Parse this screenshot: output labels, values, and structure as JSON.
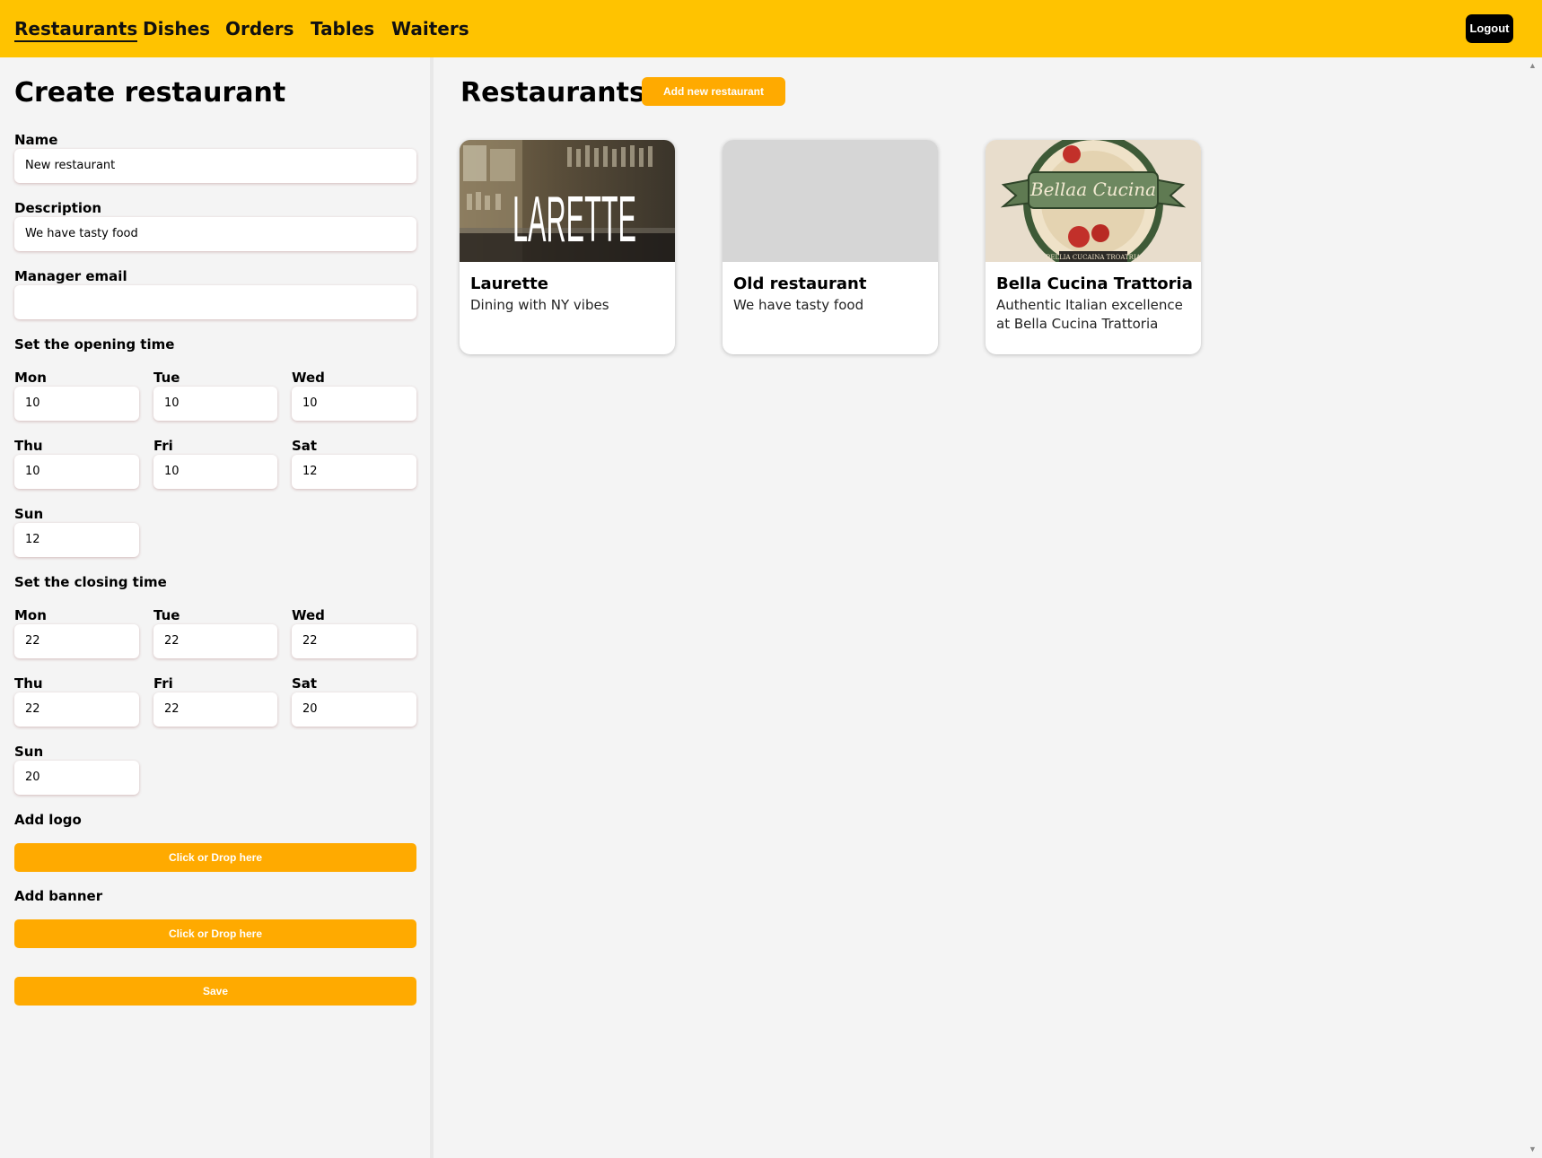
{
  "nav": {
    "items": [
      "Restaurants",
      "Dishes",
      "Orders",
      "Tables",
      "Waiters"
    ],
    "logout_label": "Logout"
  },
  "form": {
    "title": "Create restaurant",
    "name_label": "Name",
    "name_value": "New restaurant",
    "description_label": "Description",
    "description_value": "We have tasty food",
    "manager_email_label": "Manager email",
    "manager_email_value": "",
    "opening_title": "Set the opening time",
    "opening": {
      "mon_label": "Mon",
      "mon": "10",
      "tue_label": "Tue",
      "tue": "10",
      "wed_label": "Wed",
      "wed": "10",
      "thu_label": "Thu",
      "thu": "10",
      "fri_label": "Fri",
      "fri": "10",
      "sat_label": "Sat",
      "sat": "12",
      "sun_label": "Sun",
      "sun": "12"
    },
    "closing_title": "Set the closing time",
    "closing": {
      "mon_label": "Mon",
      "mon": "22",
      "tue_label": "Tue",
      "tue": "22",
      "wed_label": "Wed",
      "wed": "22",
      "thu_label": "Thu",
      "thu": "22",
      "fri_label": "Fri",
      "fri": "22",
      "sat_label": "Sat",
      "sat": "20",
      "sun_label": "Sun",
      "sun": "20"
    },
    "logo_label": "Add logo",
    "logo_button": "Click or Drop here",
    "banner_label": "Add banner",
    "banner_button": "Click or Drop here",
    "save_label": "Save"
  },
  "list": {
    "title": "Restaurants",
    "add_button": "Add new restaurant",
    "cards": [
      {
        "name": "Laurette",
        "description": "Dining with NY vibes",
        "banner_text": "LARETTE"
      },
      {
        "name": "Old restaurant",
        "description": "We have tasty food"
      },
      {
        "name": "Bella Cucina Trattoria",
        "description": "Authentic Italian excellence at Bella Cucina Trattoria",
        "banner_text": "Bellaa Cucina",
        "banner_subtext": "BELLIA CUCAINA TROATRIA"
      }
    ]
  },
  "colors": {
    "topbar": "#ffc300",
    "accent_button": "#ffaa00",
    "background": "#f4f4f4"
  }
}
